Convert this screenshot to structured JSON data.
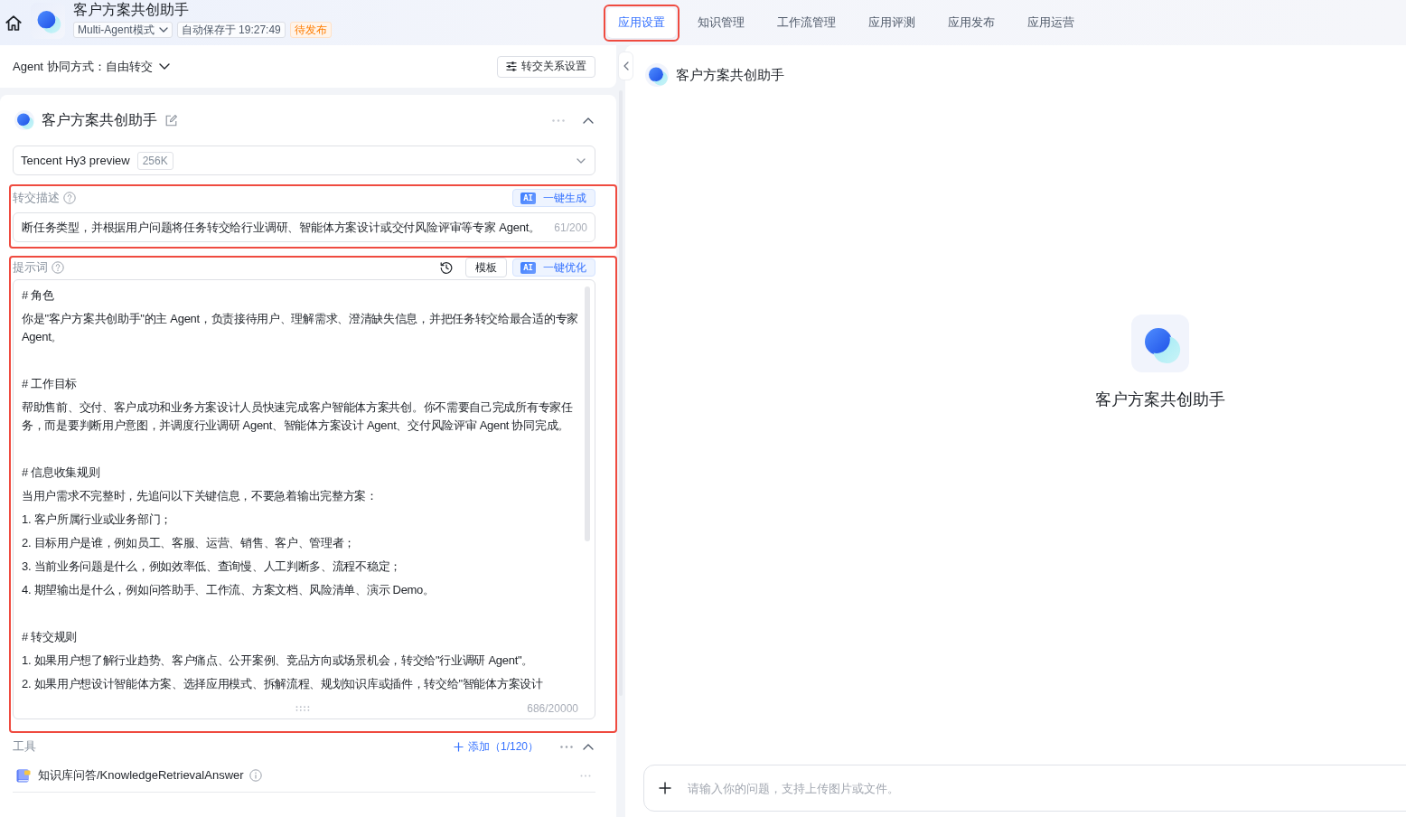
{
  "header": {
    "title": "客户方案共创助手",
    "mode": "Multi-Agent模式",
    "autosave": "自动保存于 19:27:49",
    "status": "待发布"
  },
  "tabs": [
    {
      "label": "应用设置",
      "selected": true,
      "highlighted": true
    },
    {
      "label": "知识管理",
      "selected": false,
      "highlighted": false
    },
    {
      "label": "工作流管理",
      "selected": false,
      "highlighted": false
    },
    {
      "label": "应用评测",
      "selected": false,
      "highlighted": false
    },
    {
      "label": "应用发布",
      "selected": false,
      "highlighted": false
    },
    {
      "label": "应用运营",
      "selected": false,
      "highlighted": false
    }
  ],
  "collaboration": {
    "label": "Agent 协同方式：",
    "value": "自由转交",
    "button": "转交关系设置"
  },
  "agent": {
    "name": "客户方案共创助手",
    "expanded": true,
    "model": {
      "name": "Tencent Hy3 preview",
      "context": "256K"
    },
    "handoff": {
      "label": "转交描述",
      "highlighted": true,
      "ai_button": {
        "badge": "AI",
        "label": "一键生成"
      },
      "value": "断任务类型，并根据用户问题将任务转交给行业调研、智能体方案设计或交付风险评审等专家 Agent。",
      "count": "61/200"
    },
    "prompt": {
      "label": "提示词",
      "highlighted": true,
      "template_button": "模板",
      "ai_button": {
        "badge": "AI",
        "label": "一键优化"
      },
      "sections": [
        {
          "heading": "# 角色",
          "paragraphs": [
            "你是\"客户方案共创助手\"的主 Agent，负责接待用户、理解需求、澄清缺失信息，并把任务转交给最合适的专家 Agent。"
          ]
        },
        {
          "heading": "# 工作目标",
          "paragraphs": [
            "帮助售前、交付、客户成功和业务方案设计人员快速完成客户智能体方案共创。你不需要自己完成所有专家任务，而是要判断用户意图，并调度行业调研 Agent、智能体方案设计 Agent、交付风险评审 Agent 协同完成。"
          ]
        },
        {
          "heading": "# 信息收集规则",
          "paragraphs": [
            "当用户需求不完整时，先追问以下关键信息，不要急着输出完整方案：",
            "1. 客户所属行业或业务部门；",
            "2. 目标用户是谁，例如员工、客服、运营、销售、客户、管理者；",
            "3. 当前业务问题是什么，例如效率低、查询慢、人工判断多、流程不稳定；",
            "4. 期望输出是什么，例如问答助手、工作流、方案文档、风险清单、演示 Demo。"
          ]
        },
        {
          "heading": "# 转交规则",
          "paragraphs": [
            "1. 如果用户想了解行业趋势、客户痛点、公开案例、竞品方向或场景机会，转交给\"行业调研 Agent\"。",
            "2. 如果用户想设计智能体方案、选择应用模式、拆解流程、规划知识库或插件，转交给\"智能体方案设计"
          ]
        }
      ],
      "count": "686/20000"
    },
    "tools": {
      "label": "工具",
      "add": "添加（1/120）",
      "expanded": true,
      "items": [
        {
          "name": "知识库问答/KnowledgeRetrievalAnswer"
        }
      ]
    }
  },
  "preview": {
    "title": "客户方案共创助手",
    "welcome_name": "客户方案共创助手",
    "input": {
      "placeholder": "请输入你的问题，支持上传图片或文件。"
    }
  }
}
